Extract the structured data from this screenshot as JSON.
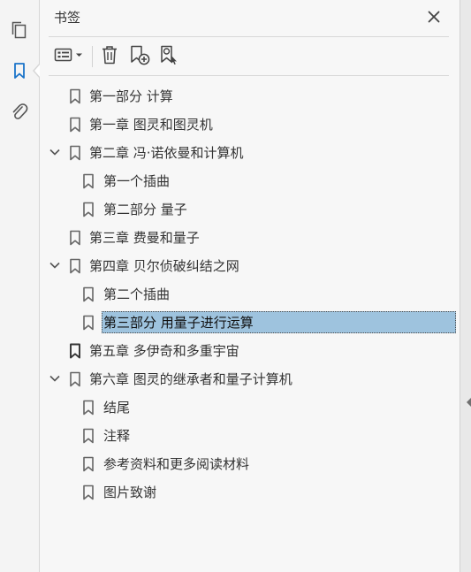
{
  "rail": {
    "items": [
      {
        "name": "page-thumbnails-icon"
      },
      {
        "name": "bookmarks-icon"
      },
      {
        "name": "attachments-icon"
      }
    ]
  },
  "panel": {
    "title": "书签",
    "close_icon": "close-icon",
    "toolbar": [
      "options-menu-icon",
      "delete-bookmark-icon",
      "new-bookmark-icon",
      "find-bookmark-icon"
    ]
  },
  "bookmarks": [
    {
      "label": "第一部分  计算",
      "level": 0,
      "expanded": null,
      "selected": false
    },
    {
      "label": "第一章  图灵和图灵机",
      "level": 0,
      "expanded": null,
      "selected": false
    },
    {
      "label": "第二章  冯·诺依曼和计算机",
      "level": 0,
      "expanded": true,
      "selected": false
    },
    {
      "label": "第一个插曲",
      "level": 1,
      "expanded": null,
      "selected": false
    },
    {
      "label": "第二部分  量子",
      "level": 1,
      "expanded": null,
      "selected": false
    },
    {
      "label": "第三章  费曼和量子",
      "level": 0,
      "expanded": null,
      "selected": false
    },
    {
      "label": "第四章  贝尔侦破纠结之网",
      "level": 0,
      "expanded": true,
      "selected": false
    },
    {
      "label": "第二个插曲",
      "level": 1,
      "expanded": null,
      "selected": false
    },
    {
      "label": "第三部分  用量子进行运算",
      "level": 1,
      "expanded": null,
      "selected": true
    },
    {
      "label": "第五章  多伊奇和多重宇宙",
      "level": 0,
      "expanded": null,
      "selected": false
    },
    {
      "label": "第六章  图灵的继承者和量子计算机",
      "level": 0,
      "expanded": true,
      "selected": false
    },
    {
      "label": "结尾",
      "level": 1,
      "expanded": null,
      "selected": false
    },
    {
      "label": "注释",
      "level": 1,
      "expanded": null,
      "selected": false
    },
    {
      "label": "参考资料和更多阅读材料",
      "level": 1,
      "expanded": null,
      "selected": false
    },
    {
      "label": "图片致谢",
      "level": 1,
      "expanded": null,
      "selected": false
    }
  ],
  "colors": {
    "accent": "#1a73c9",
    "selection": "#9ec3de",
    "icon": "#555555"
  }
}
